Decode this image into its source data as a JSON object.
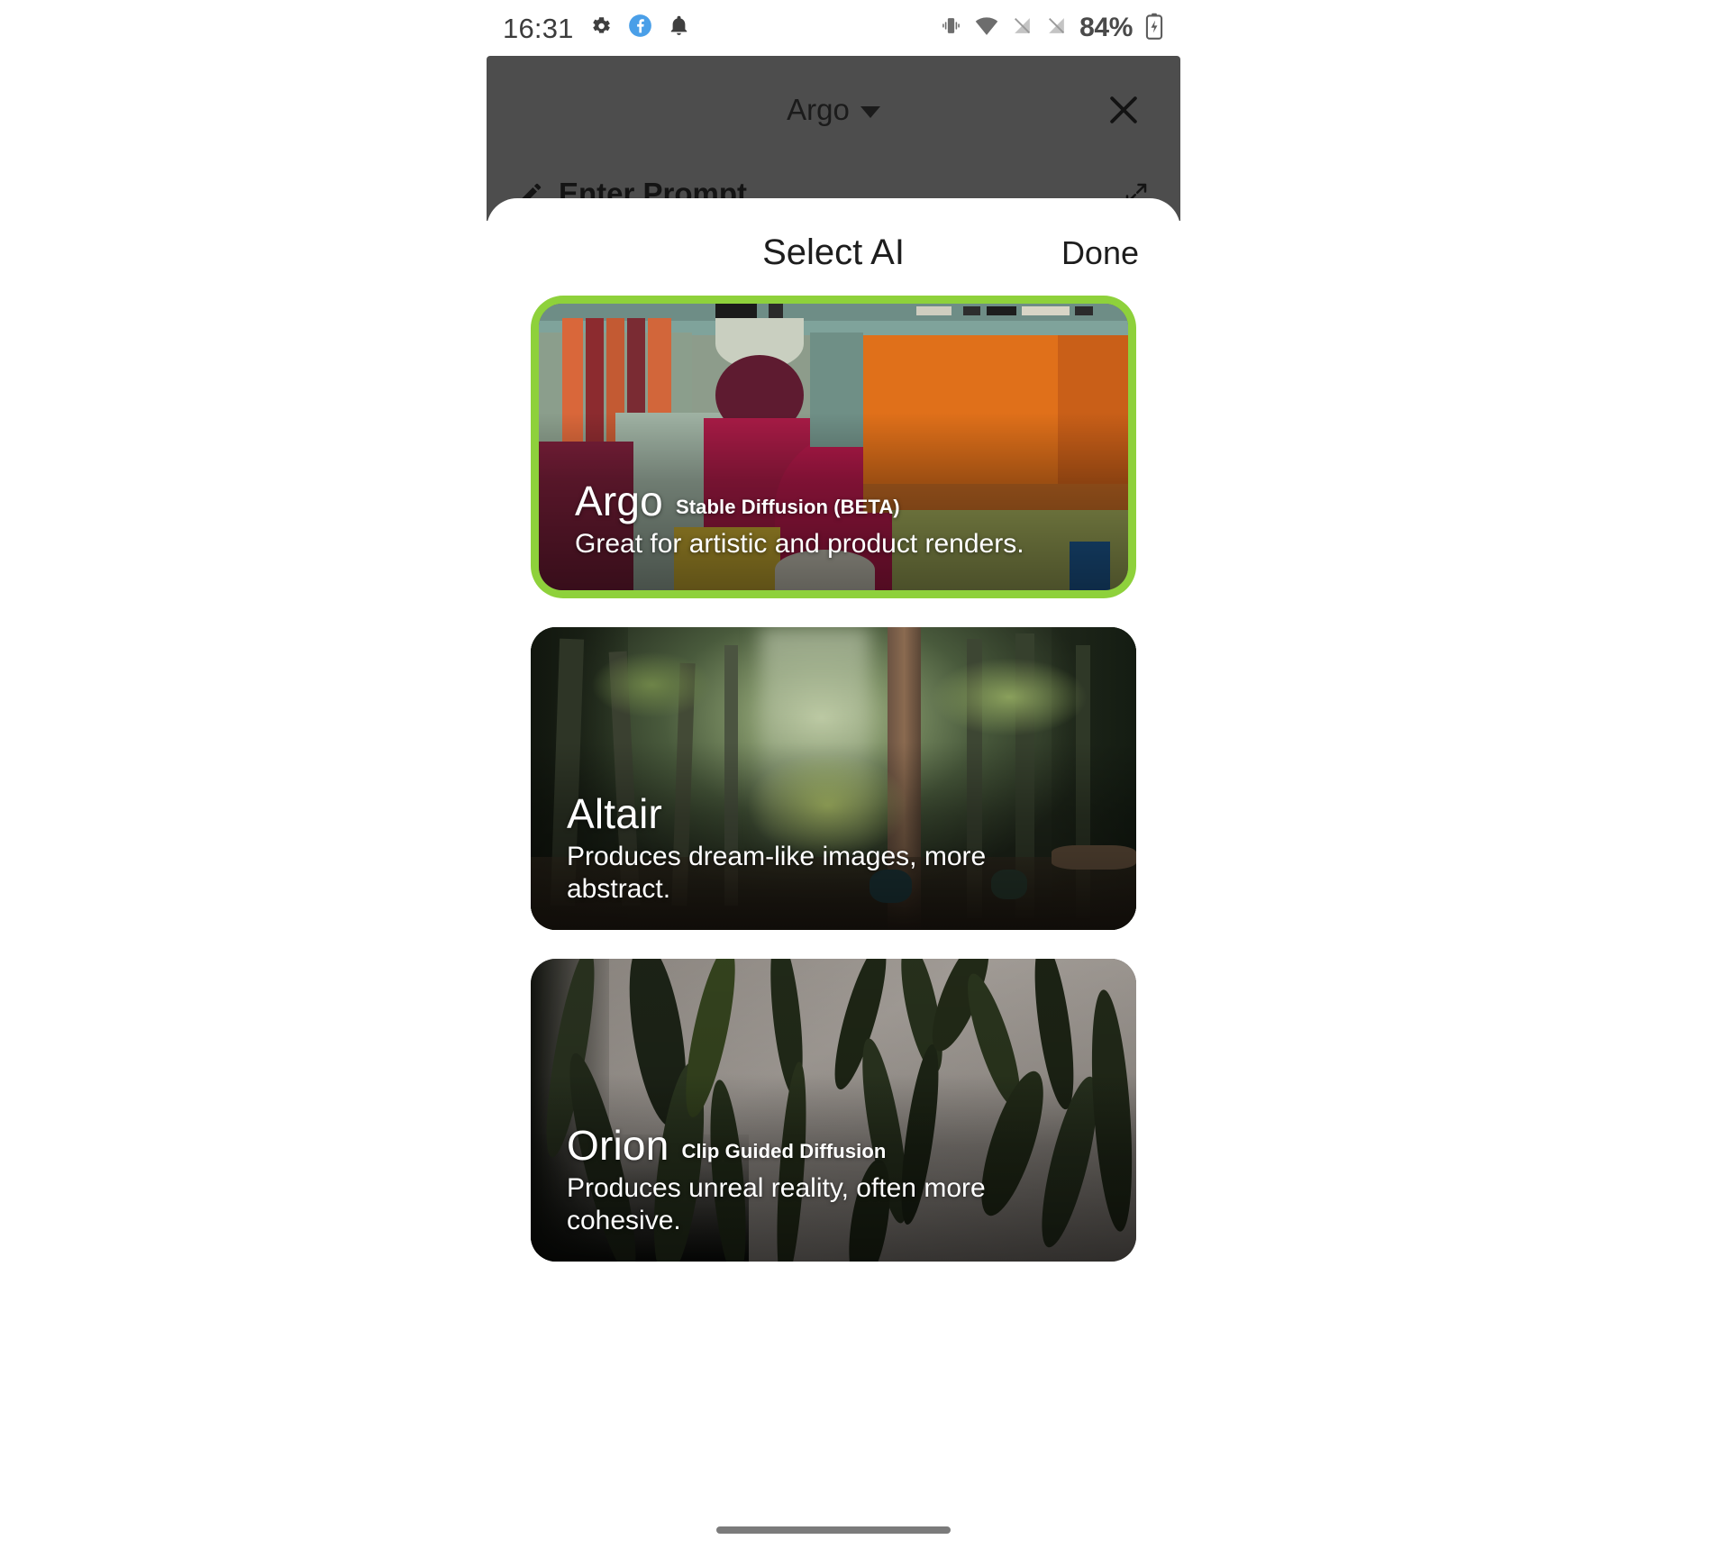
{
  "status_bar": {
    "time": "16:31",
    "battery_percent": "84%",
    "icons": [
      "gear-icon",
      "facebook-icon",
      "bell-icon",
      "vibrate-icon",
      "wifi-icon",
      "signal-off-icon",
      "signal-off-2-icon",
      "battery-icon"
    ]
  },
  "app_behind": {
    "title": "Argo",
    "dropdown_icon": "chevron-down-icon",
    "close_icon": "close-icon",
    "prompt_label": "Enter Prompt",
    "prompt_edit_icon": "pencil-icon",
    "prompt_expand_icon": "expand-icon"
  },
  "sheet": {
    "title": "Select AI",
    "done_label": "Done",
    "selection_color": "#8ed13b",
    "models": [
      {
        "name": "Argo",
        "subtitle": "Stable Diffusion (BETA)",
        "description": "Great for artistic and product renders.",
        "selected": true,
        "artwork": "abstract-color-blocks"
      },
      {
        "name": "Altair",
        "subtitle": "",
        "description": "Produces dream-like images, more abstract.",
        "selected": false,
        "artwork": "misty-forest"
      },
      {
        "name": "Orion",
        "subtitle": "Clip Guided Diffusion",
        "description": "Produces unreal reality, often more cohesive.",
        "selected": false,
        "artwork": "dark-tendrils"
      }
    ]
  },
  "home_indicator": "home-indicator-bar"
}
